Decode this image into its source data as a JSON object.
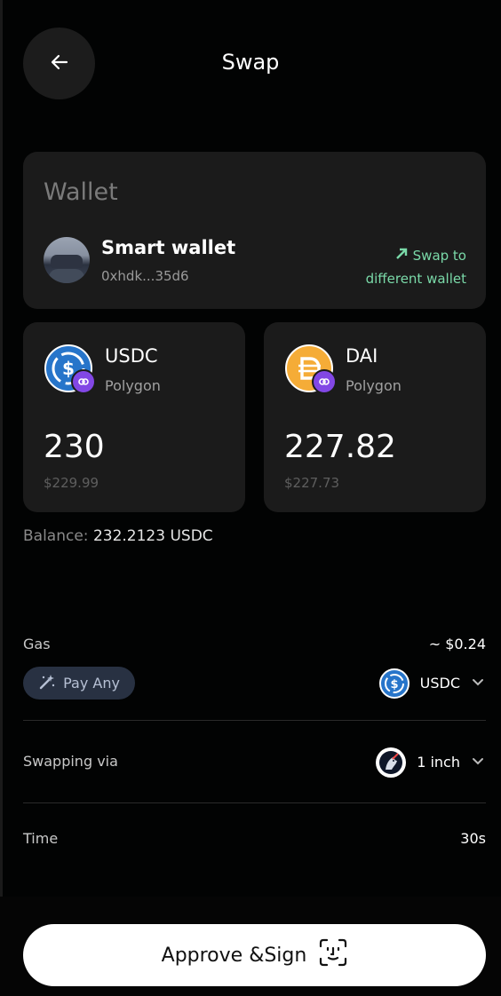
{
  "header": {
    "title": "Swap"
  },
  "wallet": {
    "section_title": "Wallet",
    "name": "Smart wallet",
    "address": "0xhdk...35d6",
    "swap_link_line1": "Swap to",
    "swap_link_line2": "different wallet"
  },
  "from_token": {
    "symbol": "USDC",
    "chain": "Polygon",
    "amount": "230",
    "usd_value": "$229.99"
  },
  "to_token": {
    "symbol": "DAI",
    "chain": "Polygon",
    "amount": "227.82",
    "usd_value": "$227.73"
  },
  "balance": {
    "label": "Balance:",
    "value": "232.2123 USDC"
  },
  "gas": {
    "label": "Gas",
    "amount": "~ $0.24",
    "pay_any_label": "Pay Any",
    "token": "USDC"
  },
  "swapping_via": {
    "label": "Swapping via",
    "provider": "1 inch"
  },
  "time": {
    "label": "Time",
    "value": "30s"
  },
  "approve_button": {
    "label": "Approve &Sign"
  },
  "colors": {
    "background": "#020303",
    "card": "#1b1b1b",
    "accent_green": "#7ad9a8",
    "usdc_blue": "#2775ca",
    "dai_orange": "#f5ac37",
    "polygon_purple": "#8247e5"
  }
}
